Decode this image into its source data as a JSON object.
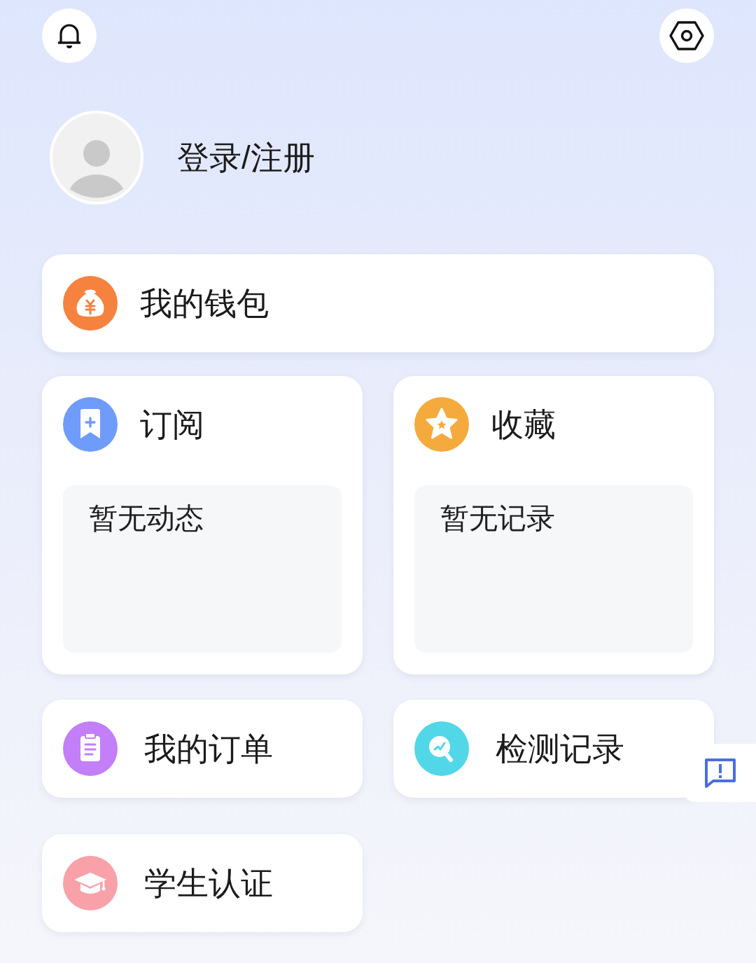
{
  "profile": {
    "login_label": "登录/注册"
  },
  "wallet": {
    "label": "我的钱包"
  },
  "panels": [
    {
      "title": "订阅",
      "empty_text": "暂无动态"
    },
    {
      "title": "收藏",
      "empty_text": "暂无记录"
    }
  ],
  "shortcuts": [
    {
      "label": "我的订单"
    },
    {
      "label": "检测记录"
    },
    {
      "label": "学生认证"
    }
  ]
}
